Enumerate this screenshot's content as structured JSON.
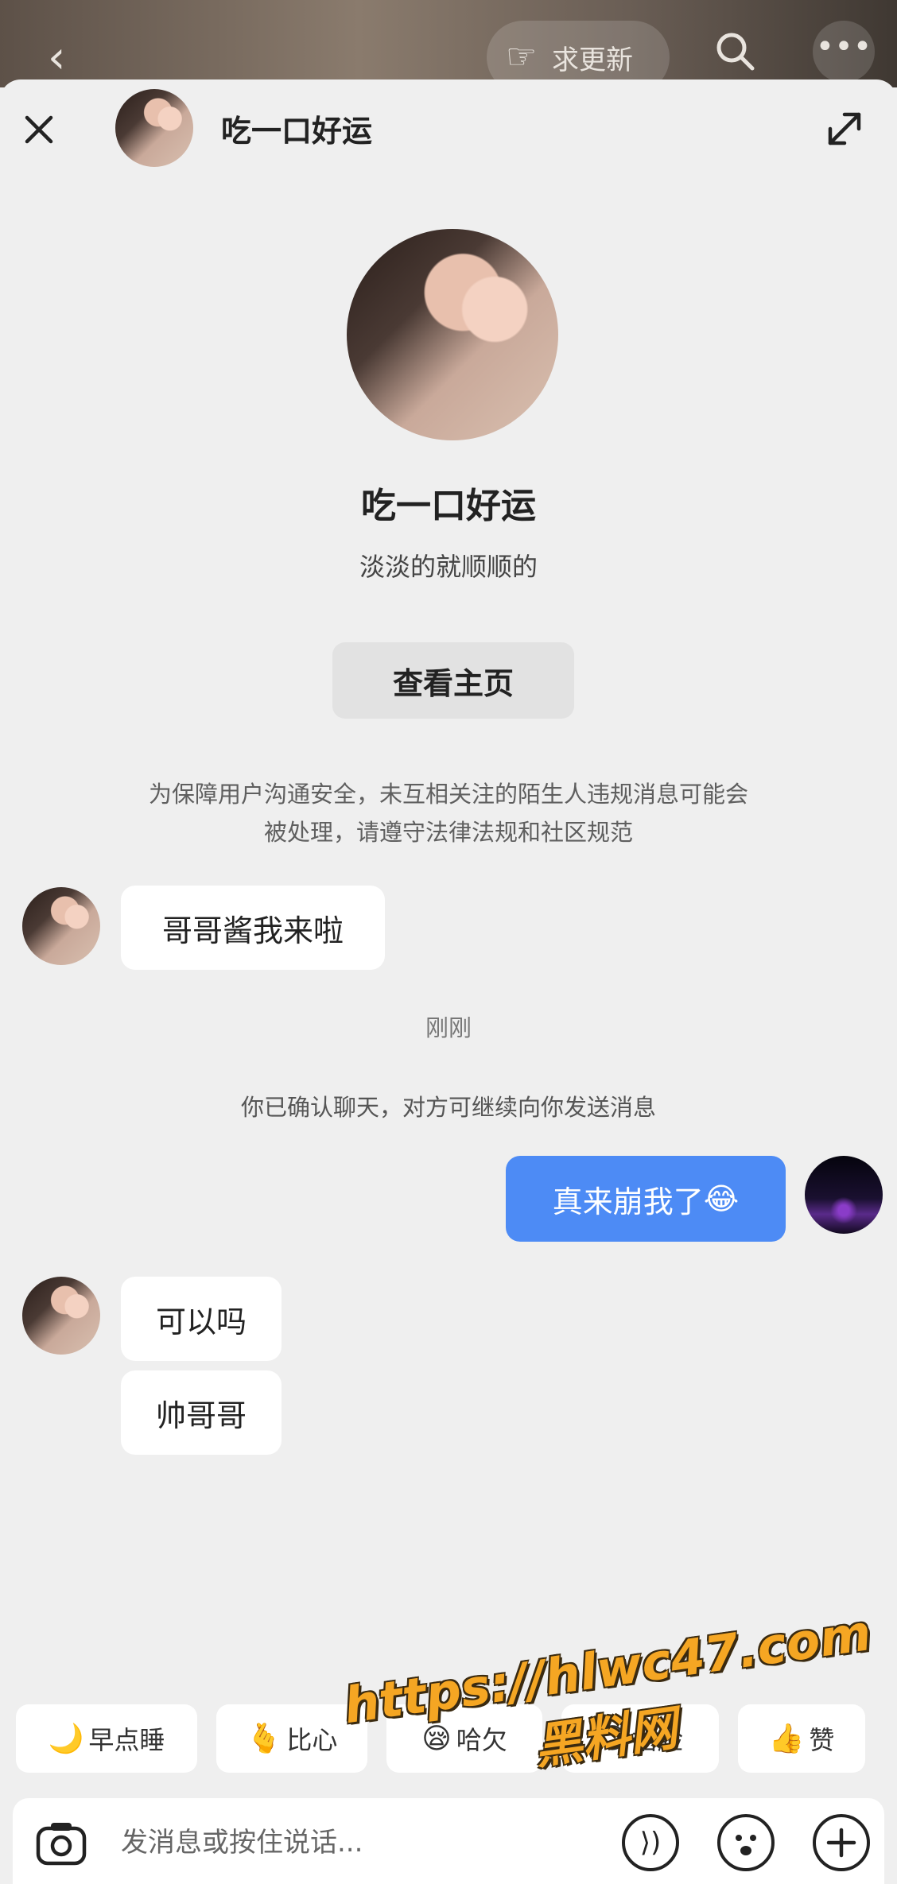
{
  "topbar": {
    "update_label": "求更新"
  },
  "header": {
    "title": "吃一口好运"
  },
  "profile": {
    "name": "吃一口好运",
    "bio": "淡淡的就顺顺的",
    "view_profile_label": "查看主页"
  },
  "notice": {
    "line1": "为保障用户沟通安全，未互相关注的陌生人违规消息可能会",
    "line2": "被处理，请遵守法律法规和社区规范"
  },
  "messages": {
    "m1": "哥哥酱我来啦",
    "time": "刚刚",
    "system": "你已确认聊天，对方可继续向你发送消息",
    "m2": "真来崩我了",
    "m2_emoji": "😂",
    "m3": "可以吗",
    "m4": "帅哥哥"
  },
  "quick_replies": [
    {
      "icon": "🌙",
      "label": "早点睡"
    },
    {
      "icon": "🫰",
      "label": "比心"
    },
    {
      "icon": "😪",
      "label": "哈欠"
    },
    {
      "icon": "😊",
      "label": "捂脸"
    },
    {
      "icon": "👍",
      "label": "赞"
    }
  ],
  "input": {
    "placeholder": "发消息或按住说话..."
  },
  "watermark": {
    "url": "https://hlwc47.com",
    "cn": "黑料网"
  },
  "colors": {
    "accent": "#4d8bf5",
    "bg": "#efefef"
  }
}
